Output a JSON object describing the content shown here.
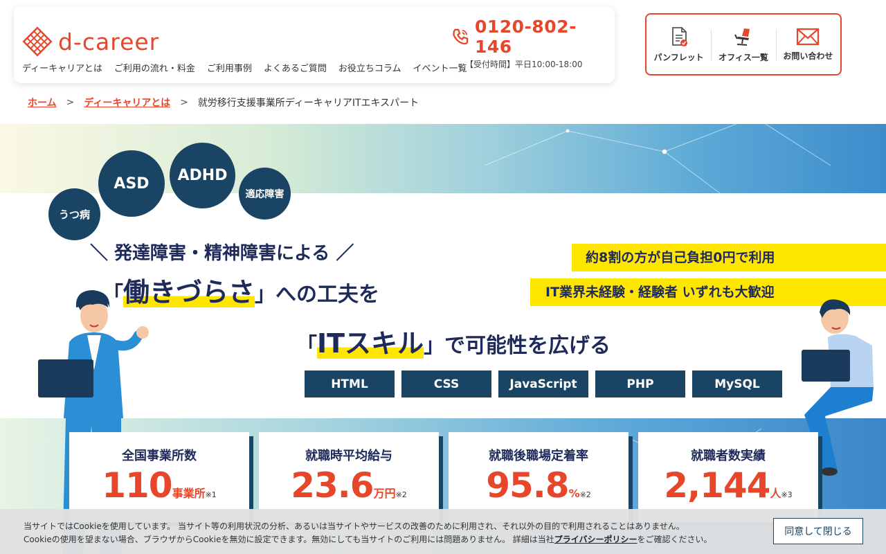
{
  "header": {
    "logo_text": "d-career",
    "phone_number": "0120-802-146",
    "phone_hours": "【受付時間】平日10:00-18:00",
    "nav": [
      "ディーキャリアとは",
      "ご利用の流れ・料金",
      "ご利用事例",
      "よくあるご質問",
      "お役立ちコラム",
      "イベント一覧"
    ],
    "quick_links": [
      {
        "label": "パンフレット",
        "icon": "pamphlet-icon"
      },
      {
        "label": "オフィス一覧",
        "icon": "office-chair-icon"
      },
      {
        "label": "お問い合わせ",
        "icon": "mail-icon"
      }
    ]
  },
  "breadcrumb": {
    "home": "ホーム",
    "sep": ">",
    "parent": "ディーキャリアとは",
    "current": "就労移行支援事業所ディーキャリアITエキスパート"
  },
  "hero": {
    "bubbles": [
      "うつ病",
      "ASD",
      "ADHD",
      "適応障害"
    ],
    "headline1": "＼ 発達障害・精神障害による ／",
    "headline2_open": "「",
    "headline2_big": "働きづらさ",
    "headline2_rest": "」への工夫を",
    "headline3_open": "「",
    "headline3_big": "ITスキル",
    "headline3_rest": "」で可能性を広げる",
    "badge1": "約8割の方が自己負担0円で利用",
    "badge2": "IT業界未経験・経験者 いずれも大歓迎",
    "skills": [
      "HTML",
      "CSS",
      "JavaScript",
      "PHP",
      "MySQL"
    ]
  },
  "stats": [
    {
      "label": "全国事業所数",
      "value": "110",
      "unit": "事業所",
      "note": "※1"
    },
    {
      "label": "就職時平均給与",
      "value": "23.6",
      "unit": "万円",
      "note": "※2"
    },
    {
      "label": "就職後職場定着率",
      "value": "95.8",
      "unit": "%",
      "note": "※2"
    },
    {
      "label": "就職者数実績",
      "value": "2,144",
      "unit": "人",
      "note": "※3"
    }
  ],
  "cookie": {
    "line1": "当サイトではCookieを使用しています。 当サイト等の利用状況の分析、あるいは当サイトやサービスの改善のために利用され、それ以外の目的で利用されることはありません。",
    "line2_a": "Cookieの使用を望まない場合、ブラウザからCookieを無効に設定できます。無効にしても当サイトのご利用には問題ありません。 詳細は当社",
    "policy_link": "プライバシーポリシー",
    "line2_b": "をご確認ください。",
    "button": "同意して閉じる"
  },
  "colors": {
    "accent": "#e8462a",
    "navy": "#1a4463",
    "yellow": "#ffe600"
  }
}
